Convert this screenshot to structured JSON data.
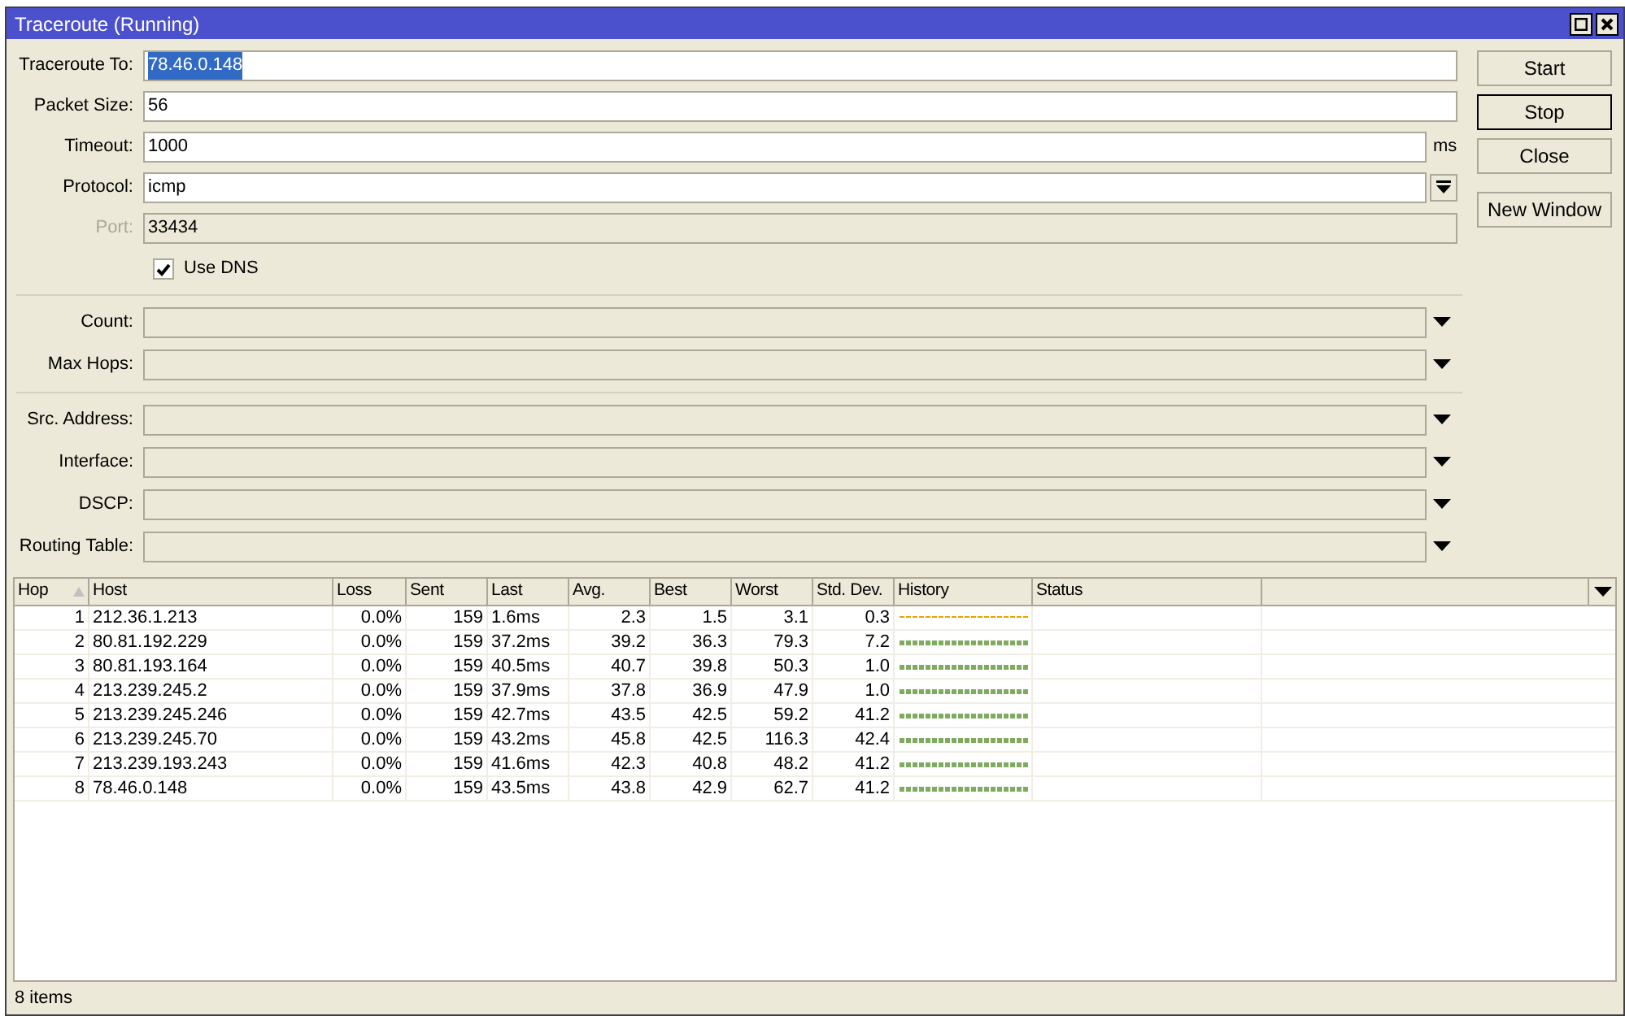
{
  "window": {
    "title": "Traceroute (Running)"
  },
  "sections": [
    {
      "fields": [
        {
          "kind": "text",
          "label": "Traceroute To:",
          "value": "78.46.0.148",
          "selected": true,
          "disabled": false
        },
        {
          "kind": "text",
          "label": "Packet Size:",
          "value": "56",
          "selected": false,
          "disabled": false
        },
        {
          "kind": "text",
          "label": "Timeout:",
          "value": "1000",
          "unit": "ms",
          "selected": false,
          "disabled": false
        },
        {
          "kind": "select",
          "label": "Protocol:",
          "value": "icmp",
          "selected": false,
          "disabled": false
        },
        {
          "kind": "text",
          "label": "Port:",
          "value": "33434",
          "selected": false,
          "disabled": true
        },
        {
          "kind": "checkbox",
          "label": "Use DNS",
          "checked": true
        }
      ]
    },
    {
      "fields": [
        {
          "kind": "optional",
          "label": "Count:"
        },
        {
          "kind": "optional",
          "label": "Max Hops:"
        }
      ]
    },
    {
      "fields": [
        {
          "kind": "optional",
          "label": "Src. Address:"
        },
        {
          "kind": "optional",
          "label": "Interface:"
        },
        {
          "kind": "optional",
          "label": "DSCP:"
        },
        {
          "kind": "optional",
          "label": "Routing Table:"
        }
      ]
    }
  ],
  "buttons": [
    {
      "label": "Start",
      "selected": false
    },
    {
      "label": "Stop",
      "selected": true
    },
    {
      "label": "Close",
      "selected": false
    },
    {
      "label": "New Window",
      "selected": false
    }
  ],
  "table": {
    "columns": [
      "Hop",
      "Host",
      "Loss",
      "Sent",
      "Last",
      "Avg.",
      "Best",
      "Worst",
      "Std. Dev.",
      "History",
      "Status"
    ],
    "rows": [
      {
        "cells": [
          "1",
          "212.36.1.213",
          "0.0%",
          "159",
          "1.6ms",
          "2.3",
          "1.5",
          "3.1",
          "0.3"
        ],
        "color": "#f0a000"
      },
      {
        "cells": [
          "2",
          "80.81.192.229",
          "0.0%",
          "159",
          "37.2ms",
          "39.2",
          "36.3",
          "79.3",
          "7.2"
        ],
        "color": "#7fab5f"
      },
      {
        "cells": [
          "3",
          "80.81.193.164",
          "0.0%",
          "159",
          "40.5ms",
          "40.7",
          "39.8",
          "50.3",
          "1.0"
        ],
        "color": "#7fab5f"
      },
      {
        "cells": [
          "4",
          "213.239.245.2",
          "0.0%",
          "159",
          "37.9ms",
          "37.8",
          "36.9",
          "47.9",
          "1.0"
        ],
        "color": "#7fab5f"
      },
      {
        "cells": [
          "5",
          "213.239.245.246",
          "0.0%",
          "159",
          "42.7ms",
          "43.5",
          "42.5",
          "59.2",
          "41.2"
        ],
        "color": "#7fab5f"
      },
      {
        "cells": [
          "6",
          "213.239.245.70",
          "0.0%",
          "159",
          "43.2ms",
          "45.8",
          "42.5",
          "116.3",
          "42.4"
        ],
        "color": "#7fab5f"
      },
      {
        "cells": [
          "7",
          "213.239.193.243",
          "0.0%",
          "159",
          "41.6ms",
          "42.3",
          "40.8",
          "48.2",
          "41.2"
        ],
        "color": "#7fab5f"
      },
      {
        "cells": [
          "8",
          "78.46.0.148",
          "0.0%",
          "159",
          "43.5ms",
          "43.8",
          "42.9",
          "62.7",
          "41.2"
        ],
        "color": "#7fab5f"
      }
    ]
  },
  "status_bar": "8 items"
}
